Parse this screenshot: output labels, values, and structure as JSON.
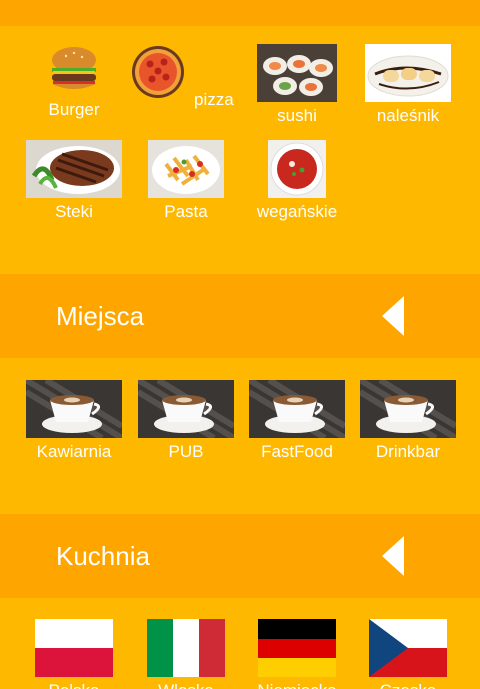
{
  "food_categories": [
    {
      "label": "Burger",
      "icon": "burger-icon"
    },
    {
      "label": "pizza",
      "icon": "pizza-icon"
    },
    {
      "label": "sushi",
      "icon": "sushi-icon"
    },
    {
      "label": "naleśnik",
      "icon": "crepe-icon"
    },
    {
      "label": "Steki",
      "icon": "steak-icon"
    },
    {
      "label": "Pasta",
      "icon": "pasta-icon"
    },
    {
      "label": "wegańskie",
      "icon": "soup-icon"
    }
  ],
  "places_section": {
    "title": "Miejsca",
    "collapse_icon": "triangle-left-icon",
    "items": [
      {
        "label": "Kawiarnia",
        "icon": "coffee-cup-icon"
      },
      {
        "label": "PUB",
        "icon": "coffee-cup-icon"
      },
      {
        "label": "FastFood",
        "icon": "coffee-cup-icon"
      },
      {
        "label": "Drinkbar",
        "icon": "coffee-cup-icon"
      }
    ]
  },
  "cuisine_section": {
    "title": "Kuchnia",
    "collapse_icon": "triangle-left-icon",
    "items": [
      {
        "label": "Polska",
        "icon": "flag-poland-icon"
      },
      {
        "label": "Włoska",
        "icon": "flag-italy-icon"
      },
      {
        "label": "Niemiecka",
        "icon": "flag-germany-icon"
      },
      {
        "label": "Czeska",
        "icon": "flag-czech-icon"
      }
    ]
  },
  "colors": {
    "background": "#FFB800",
    "header_band": "#FFA500",
    "text": "#FFFFFF"
  }
}
